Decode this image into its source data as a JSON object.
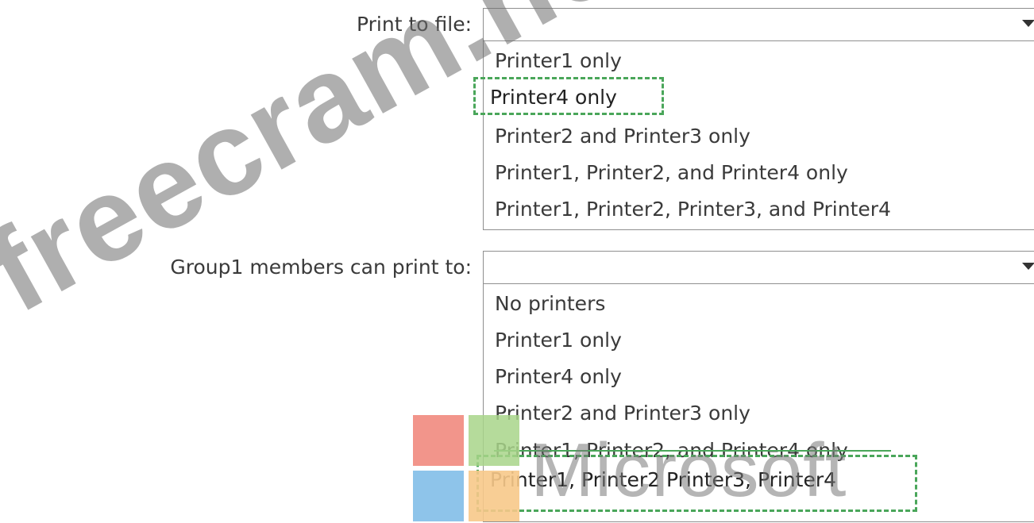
{
  "questions": [
    {
      "label": "Print to file:",
      "selected": "",
      "options": [
        "Printer1 only",
        "Printer4 only",
        "Printer2 and Printer3 only",
        "Printer1, Printer2, and Printer4 only",
        "Printer1, Printer2, Printer3, and Printer4"
      ],
      "highlighted_option": "Printer4 only"
    },
    {
      "label": "Group1 members can print to:",
      "selected": "",
      "options": [
        "No printers",
        "Printer1 only",
        "Printer4 only",
        "Printer2 and Printer3 only",
        "Printer1, Printer2, and Printer4 only",
        "Printer1, Printer2 Printer3, Printer4"
      ],
      "highlighted_option": "Printer1, Printer2 Printer3, Printer4"
    }
  ],
  "watermarks": {
    "site": "freecram.net",
    "brand": "Microsoft"
  },
  "colors": {
    "highlight_border": "#4aa65a",
    "ms_red": "#f25022",
    "ms_green": "#7fba00",
    "ms_blue": "#00a4ef",
    "ms_yellow": "#ffb900"
  },
  "icons": {
    "dropdown": "caret-down-icon",
    "logo": "microsoft-logo-icon"
  }
}
